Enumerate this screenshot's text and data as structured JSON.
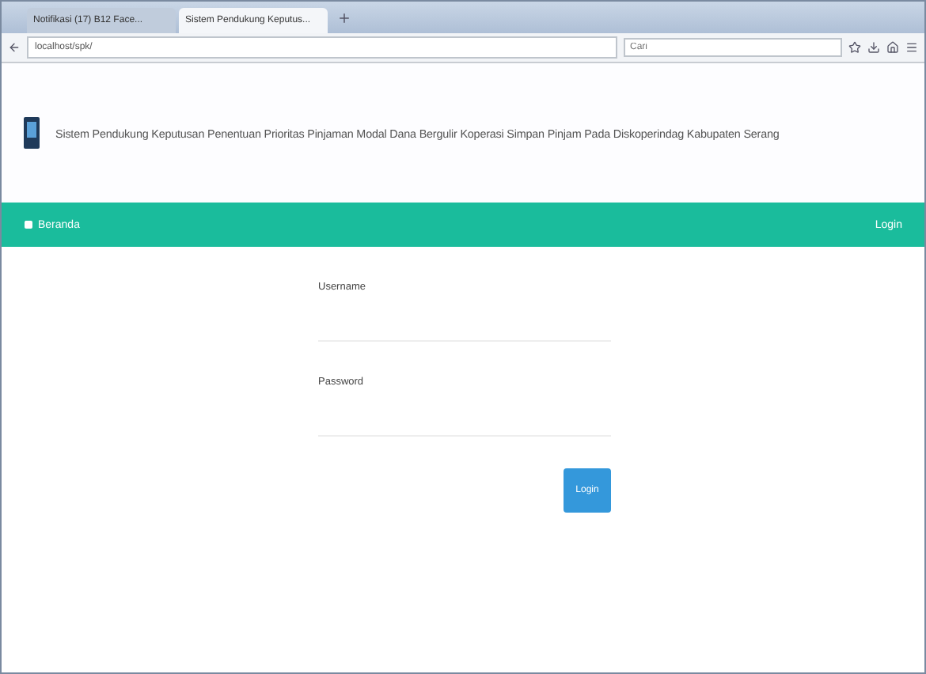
{
  "browser": {
    "tabs": [
      {
        "label": "Notifikasi (17) B12 Face...",
        "selected": false
      },
      {
        "label": "Sistem Pendukung Keputus...",
        "selected": true
      }
    ],
    "address": "localhost/spk/",
    "search": {
      "placeholder": "Cari"
    }
  },
  "header": {
    "title": "Sistem Pendukung Keputusan Penentuan Prioritas Pinjaman Modal Dana Bergulir Koperasi Simpan Pinjam Pada Diskoperindag Kabupaten Serang"
  },
  "navbar": {
    "home": "Beranda",
    "login": "Login"
  },
  "form": {
    "fields": [
      {
        "label": "Username"
      },
      {
        "label": "Password"
      }
    ],
    "button": "Login"
  }
}
